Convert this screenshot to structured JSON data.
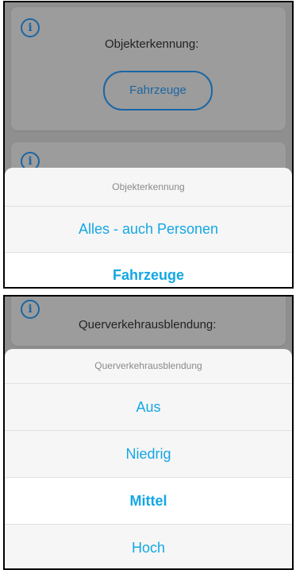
{
  "screen1": {
    "setting_label": "Objekterkennung:",
    "current_value": "Fahrzeuge",
    "sheet_title": "Objekterkennung",
    "options": [
      {
        "label": "Alles - auch Personen",
        "selected": false
      },
      {
        "label": "Fahrzeuge",
        "selected": true
      }
    ]
  },
  "screen2": {
    "setting_label": "Querverkehrausblendung:",
    "sheet_title": "Querverkehrausblendung",
    "options": [
      {
        "label": "Aus",
        "selected": false
      },
      {
        "label": "Niedrig",
        "selected": false
      },
      {
        "label": "Mittel",
        "selected": true
      },
      {
        "label": "Hoch",
        "selected": false
      }
    ]
  },
  "colors": {
    "accent": "#14a7e4",
    "icon_blue": "#1b66a3",
    "dim_overlay": "#8f8f8f",
    "sheet_bg": "#f6f6f6"
  },
  "icons": {
    "info": "info-icon"
  }
}
